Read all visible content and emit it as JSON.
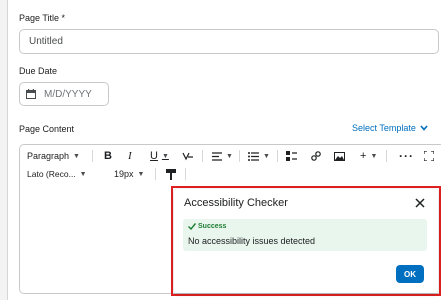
{
  "form": {
    "page_title_label": "Page Title *",
    "page_title_value": "Untitled",
    "due_date_label": "Due Date",
    "due_date_placeholder": "M/D/YYYY",
    "page_content_label": "Page Content",
    "select_template_label": "Select Template"
  },
  "toolbar": {
    "format_select": "Paragraph",
    "font_select": "Lato (Reco...",
    "size_select": "19px",
    "icons_row1": [
      "paragraph-format",
      "bold-icon",
      "italic-icon",
      "underline-icon",
      "strikethrough-format-icon",
      "align-icon",
      "list-icon",
      "insert-stuff-icon",
      "link-icon",
      "image-icon",
      "add-icon",
      "more-icon",
      "fullscreen-icon"
    ],
    "icons_row2": [
      "format-painter-icon",
      "accessibility-check-icon",
      "word-count-icon",
      "find-icon",
      "source-code-icon",
      "undo-icon",
      "redo-icon"
    ]
  },
  "dialog": {
    "title": "Accessibility Checker",
    "status_label": "Success",
    "message": "No accessibility issues detected",
    "ok_label": "OK"
  },
  "colors": {
    "accent": "#006fbf",
    "success_bg": "#e8f6ee",
    "success_text": "#1e7d32",
    "highlight": "#e02020"
  }
}
